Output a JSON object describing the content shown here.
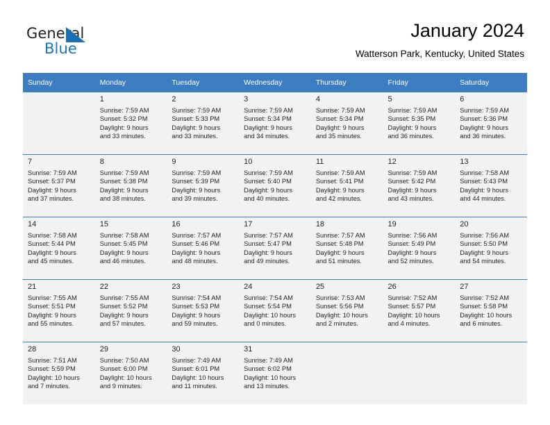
{
  "brand": {
    "name_part1": "General",
    "name_part2": "Blue",
    "triangle_color": "#1b6fb5",
    "blue_color": "#1b75bb"
  },
  "header": {
    "title": "January 2024",
    "subtitle": "Watterson Park, Kentucky, United States",
    "accent_color": "#3b7dc0",
    "shaded_cell_color": "#f2f2f2"
  },
  "calendar": {
    "weekdays": [
      "Sunday",
      "Monday",
      "Tuesday",
      "Wednesday",
      "Thursday",
      "Friday",
      "Saturday"
    ],
    "weeks": [
      [
        {
          "day": "",
          "sunrise": "",
          "sunset": "",
          "daylight_line1": "",
          "daylight_line2": ""
        },
        {
          "day": "1",
          "sunrise": "Sunrise: 7:59 AM",
          "sunset": "Sunset: 5:32 PM",
          "daylight_line1": "Daylight: 9 hours",
          "daylight_line2": "and 33 minutes."
        },
        {
          "day": "2",
          "sunrise": "Sunrise: 7:59 AM",
          "sunset": "Sunset: 5:33 PM",
          "daylight_line1": "Daylight: 9 hours",
          "daylight_line2": "and 33 minutes."
        },
        {
          "day": "3",
          "sunrise": "Sunrise: 7:59 AM",
          "sunset": "Sunset: 5:34 PM",
          "daylight_line1": "Daylight: 9 hours",
          "daylight_line2": "and 34 minutes."
        },
        {
          "day": "4",
          "sunrise": "Sunrise: 7:59 AM",
          "sunset": "Sunset: 5:34 PM",
          "daylight_line1": "Daylight: 9 hours",
          "daylight_line2": "and 35 minutes."
        },
        {
          "day": "5",
          "sunrise": "Sunrise: 7:59 AM",
          "sunset": "Sunset: 5:35 PM",
          "daylight_line1": "Daylight: 9 hours",
          "daylight_line2": "and 36 minutes."
        },
        {
          "day": "6",
          "sunrise": "Sunrise: 7:59 AM",
          "sunset": "Sunset: 5:36 PM",
          "daylight_line1": "Daylight: 9 hours",
          "daylight_line2": "and 36 minutes."
        }
      ],
      [
        {
          "day": "7",
          "sunrise": "Sunrise: 7:59 AM",
          "sunset": "Sunset: 5:37 PM",
          "daylight_line1": "Daylight: 9 hours",
          "daylight_line2": "and 37 minutes."
        },
        {
          "day": "8",
          "sunrise": "Sunrise: 7:59 AM",
          "sunset": "Sunset: 5:38 PM",
          "daylight_line1": "Daylight: 9 hours",
          "daylight_line2": "and 38 minutes."
        },
        {
          "day": "9",
          "sunrise": "Sunrise: 7:59 AM",
          "sunset": "Sunset: 5:39 PM",
          "daylight_line1": "Daylight: 9 hours",
          "daylight_line2": "and 39 minutes."
        },
        {
          "day": "10",
          "sunrise": "Sunrise: 7:59 AM",
          "sunset": "Sunset: 5:40 PM",
          "daylight_line1": "Daylight: 9 hours",
          "daylight_line2": "and 40 minutes."
        },
        {
          "day": "11",
          "sunrise": "Sunrise: 7:59 AM",
          "sunset": "Sunset: 5:41 PM",
          "daylight_line1": "Daylight: 9 hours",
          "daylight_line2": "and 42 minutes."
        },
        {
          "day": "12",
          "sunrise": "Sunrise: 7:59 AM",
          "sunset": "Sunset: 5:42 PM",
          "daylight_line1": "Daylight: 9 hours",
          "daylight_line2": "and 43 minutes."
        },
        {
          "day": "13",
          "sunrise": "Sunrise: 7:58 AM",
          "sunset": "Sunset: 5:43 PM",
          "daylight_line1": "Daylight: 9 hours",
          "daylight_line2": "and 44 minutes."
        }
      ],
      [
        {
          "day": "14",
          "sunrise": "Sunrise: 7:58 AM",
          "sunset": "Sunset: 5:44 PM",
          "daylight_line1": "Daylight: 9 hours",
          "daylight_line2": "and 45 minutes."
        },
        {
          "day": "15",
          "sunrise": "Sunrise: 7:58 AM",
          "sunset": "Sunset: 5:45 PM",
          "daylight_line1": "Daylight: 9 hours",
          "daylight_line2": "and 46 minutes."
        },
        {
          "day": "16",
          "sunrise": "Sunrise: 7:57 AM",
          "sunset": "Sunset: 5:46 PM",
          "daylight_line1": "Daylight: 9 hours",
          "daylight_line2": "and 48 minutes."
        },
        {
          "day": "17",
          "sunrise": "Sunrise: 7:57 AM",
          "sunset": "Sunset: 5:47 PM",
          "daylight_line1": "Daylight: 9 hours",
          "daylight_line2": "and 49 minutes."
        },
        {
          "day": "18",
          "sunrise": "Sunrise: 7:57 AM",
          "sunset": "Sunset: 5:48 PM",
          "daylight_line1": "Daylight: 9 hours",
          "daylight_line2": "and 51 minutes."
        },
        {
          "day": "19",
          "sunrise": "Sunrise: 7:56 AM",
          "sunset": "Sunset: 5:49 PM",
          "daylight_line1": "Daylight: 9 hours",
          "daylight_line2": "and 52 minutes."
        },
        {
          "day": "20",
          "sunrise": "Sunrise: 7:56 AM",
          "sunset": "Sunset: 5:50 PM",
          "daylight_line1": "Daylight: 9 hours",
          "daylight_line2": "and 54 minutes."
        }
      ],
      [
        {
          "day": "21",
          "sunrise": "Sunrise: 7:55 AM",
          "sunset": "Sunset: 5:51 PM",
          "daylight_line1": "Daylight: 9 hours",
          "daylight_line2": "and 55 minutes."
        },
        {
          "day": "22",
          "sunrise": "Sunrise: 7:55 AM",
          "sunset": "Sunset: 5:52 PM",
          "daylight_line1": "Daylight: 9 hours",
          "daylight_line2": "and 57 minutes."
        },
        {
          "day": "23",
          "sunrise": "Sunrise: 7:54 AM",
          "sunset": "Sunset: 5:53 PM",
          "daylight_line1": "Daylight: 9 hours",
          "daylight_line2": "and 59 minutes."
        },
        {
          "day": "24",
          "sunrise": "Sunrise: 7:54 AM",
          "sunset": "Sunset: 5:54 PM",
          "daylight_line1": "Daylight: 10 hours",
          "daylight_line2": "and 0 minutes."
        },
        {
          "day": "25",
          "sunrise": "Sunrise: 7:53 AM",
          "sunset": "Sunset: 5:56 PM",
          "daylight_line1": "Daylight: 10 hours",
          "daylight_line2": "and 2 minutes."
        },
        {
          "day": "26",
          "sunrise": "Sunrise: 7:52 AM",
          "sunset": "Sunset: 5:57 PM",
          "daylight_line1": "Daylight: 10 hours",
          "daylight_line2": "and 4 minutes."
        },
        {
          "day": "27",
          "sunrise": "Sunrise: 7:52 AM",
          "sunset": "Sunset: 5:58 PM",
          "daylight_line1": "Daylight: 10 hours",
          "daylight_line2": "and 6 minutes."
        }
      ],
      [
        {
          "day": "28",
          "sunrise": "Sunrise: 7:51 AM",
          "sunset": "Sunset: 5:59 PM",
          "daylight_line1": "Daylight: 10 hours",
          "daylight_line2": "and 7 minutes."
        },
        {
          "day": "29",
          "sunrise": "Sunrise: 7:50 AM",
          "sunset": "Sunset: 6:00 PM",
          "daylight_line1": "Daylight: 10 hours",
          "daylight_line2": "and 9 minutes."
        },
        {
          "day": "30",
          "sunrise": "Sunrise: 7:49 AM",
          "sunset": "Sunset: 6:01 PM",
          "daylight_line1": "Daylight: 10 hours",
          "daylight_line2": "and 11 minutes."
        },
        {
          "day": "31",
          "sunrise": "Sunrise: 7:49 AM",
          "sunset": "Sunset: 6:02 PM",
          "daylight_line1": "Daylight: 10 hours",
          "daylight_line2": "and 13 minutes."
        },
        {
          "day": "",
          "sunrise": "",
          "sunset": "",
          "daylight_line1": "",
          "daylight_line2": ""
        },
        {
          "day": "",
          "sunrise": "",
          "sunset": "",
          "daylight_line1": "",
          "daylight_line2": ""
        },
        {
          "day": "",
          "sunrise": "",
          "sunset": "",
          "daylight_line1": "",
          "daylight_line2": ""
        }
      ]
    ]
  }
}
